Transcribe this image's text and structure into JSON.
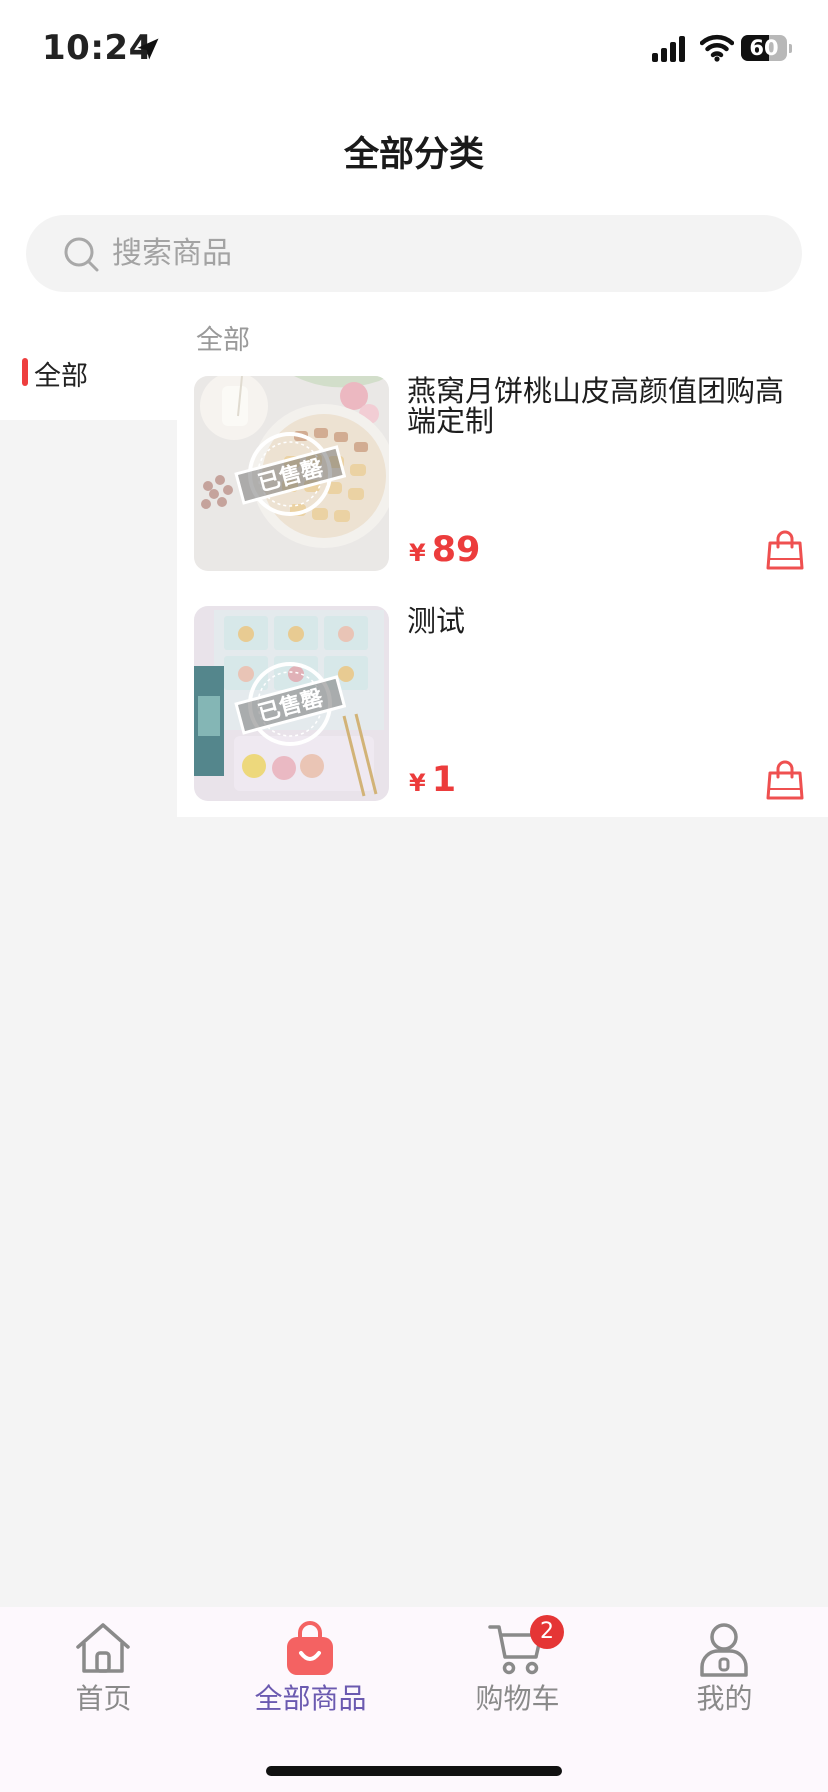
{
  "status_bar": {
    "time": "10:24",
    "battery_level": "60",
    "battery_fraction": 0.6
  },
  "header": {
    "title": "全部分类"
  },
  "search": {
    "placeholder": "搜索商品",
    "value": ""
  },
  "sidebar": {
    "items": [
      {
        "label": "全部",
        "active": true
      }
    ]
  },
  "content": {
    "section_title": "全部",
    "currency": "¥",
    "products": [
      {
        "name": "燕窝月饼桃山皮高颜值团购高端定制",
        "price": "89",
        "sold_out": true,
        "sold_label": "已售罄"
      },
      {
        "name": "测试",
        "price": "1",
        "sold_out": true,
        "sold_label": "已售罄"
      }
    ]
  },
  "tabbar": {
    "tabs": [
      {
        "label": "首页",
        "icon": "home-icon",
        "active": false
      },
      {
        "label": "全部商品",
        "icon": "shopping-bag-icon",
        "active": true
      },
      {
        "label": "购物车",
        "icon": "cart-icon",
        "active": false,
        "badge": "2"
      },
      {
        "label": "我的",
        "icon": "profile-icon",
        "active": false
      }
    ]
  },
  "colors": {
    "accent": "#ec3c3c",
    "active_tab": "#6b5ab0",
    "tabbar_bg": "#fdf8fd",
    "page_bg": "#f4f4f4"
  }
}
